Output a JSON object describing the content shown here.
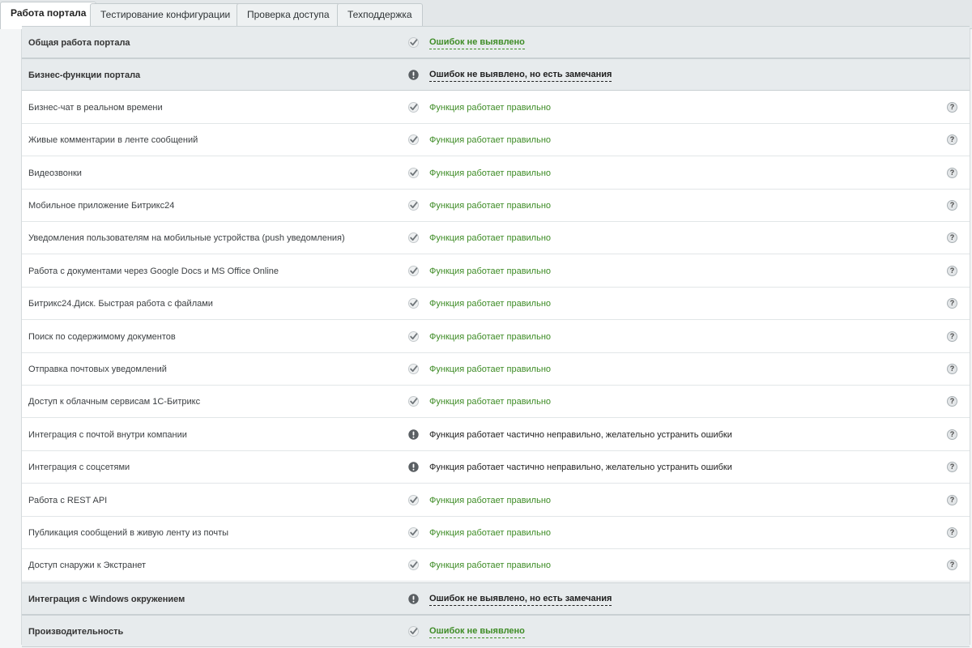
{
  "tabs": [
    {
      "label": "Работа портала",
      "active": true
    },
    {
      "label": "Тестирование конфигурации",
      "active": false
    },
    {
      "label": "Проверка доступа",
      "active": false
    },
    {
      "label": "Техподдержка",
      "active": false
    }
  ],
  "rows": [
    {
      "name": "Общая работа портала",
      "status": "Ошибок не выявлено",
      "kind": "ok",
      "group": true
    },
    {
      "name": "Бизнес-функции портала",
      "status": "Ошибок не выявлено, но есть замечания",
      "kind": "warn",
      "group": true
    },
    {
      "name": "Бизнес-чат в реальном времени",
      "status": "Функция работает правильно",
      "kind": "ok",
      "group": false,
      "help": "?"
    },
    {
      "name": "Живые комментарии в ленте сообщений",
      "status": "Функция работает правильно",
      "kind": "ok",
      "group": false,
      "help": "?"
    },
    {
      "name": "Видеозвонки",
      "status": "Функция работает правильно",
      "kind": "ok",
      "group": false,
      "help": "?"
    },
    {
      "name": "Мобильное приложение Битрикс24",
      "status": "Функция работает правильно",
      "kind": "ok",
      "group": false,
      "help": "?"
    },
    {
      "name": "Уведомления пользователям на мобильные устройства (push уведомления)",
      "status": "Функция работает правильно",
      "kind": "ok",
      "group": false,
      "help": "?"
    },
    {
      "name": "Работа с документами через Google Docs и MS Office Online",
      "status": "Функция работает правильно",
      "kind": "ok",
      "group": false,
      "help": "?"
    },
    {
      "name": "Битрикс24.Диск. Быстрая работа с файлами",
      "status": "Функция работает правильно",
      "kind": "ok",
      "group": false,
      "help": "?"
    },
    {
      "name": "Поиск по содержимому документов",
      "status": "Функция работает правильно",
      "kind": "ok",
      "group": false,
      "help": "?"
    },
    {
      "name": "Отправка почтовых уведомлений",
      "status": "Функция работает правильно",
      "kind": "ok",
      "group": false,
      "help": "?"
    },
    {
      "name": "Доступ к облачным сервисам 1С-Битрикс",
      "status": "Функция работает правильно",
      "kind": "ok",
      "group": false,
      "help": "?"
    },
    {
      "name": "Интеграция с почтой внутри компании",
      "status": "Функция работает частично неправильно, желательно устранить ошибки",
      "kind": "warn",
      "group": false,
      "help": "?"
    },
    {
      "name": "Интеграция с соцсетями",
      "status": "Функция работает частично неправильно, желательно устранить ошибки",
      "kind": "warn",
      "group": false,
      "help": "?"
    },
    {
      "name": "Работа с REST API",
      "status": "Функция работает правильно",
      "kind": "ok",
      "group": false,
      "help": "?"
    },
    {
      "name": "Публикация сообщений в живую ленту из почты",
      "status": "Функция работает правильно",
      "kind": "ok",
      "group": false,
      "help": "?"
    },
    {
      "name": "Доступ снаружи к Экстранет",
      "status": "Функция работает правильно",
      "kind": "ok",
      "group": false,
      "help": "?"
    },
    {
      "name": "Интеграция с Windows окружением",
      "status": "Ошибок не выявлено, но есть замечания",
      "kind": "warn",
      "group": true
    },
    {
      "name": "Производительность",
      "status": "Ошибок не выявлено",
      "kind": "ok",
      "group": true
    }
  ],
  "icons": {
    "ok": "check-icon",
    "warn": "exclamation-icon",
    "help": "help-icon"
  },
  "colors": {
    "ok_text": "#3e8c26",
    "warn_text": "#1f1f1f",
    "group_bg": "#e7ebed"
  }
}
